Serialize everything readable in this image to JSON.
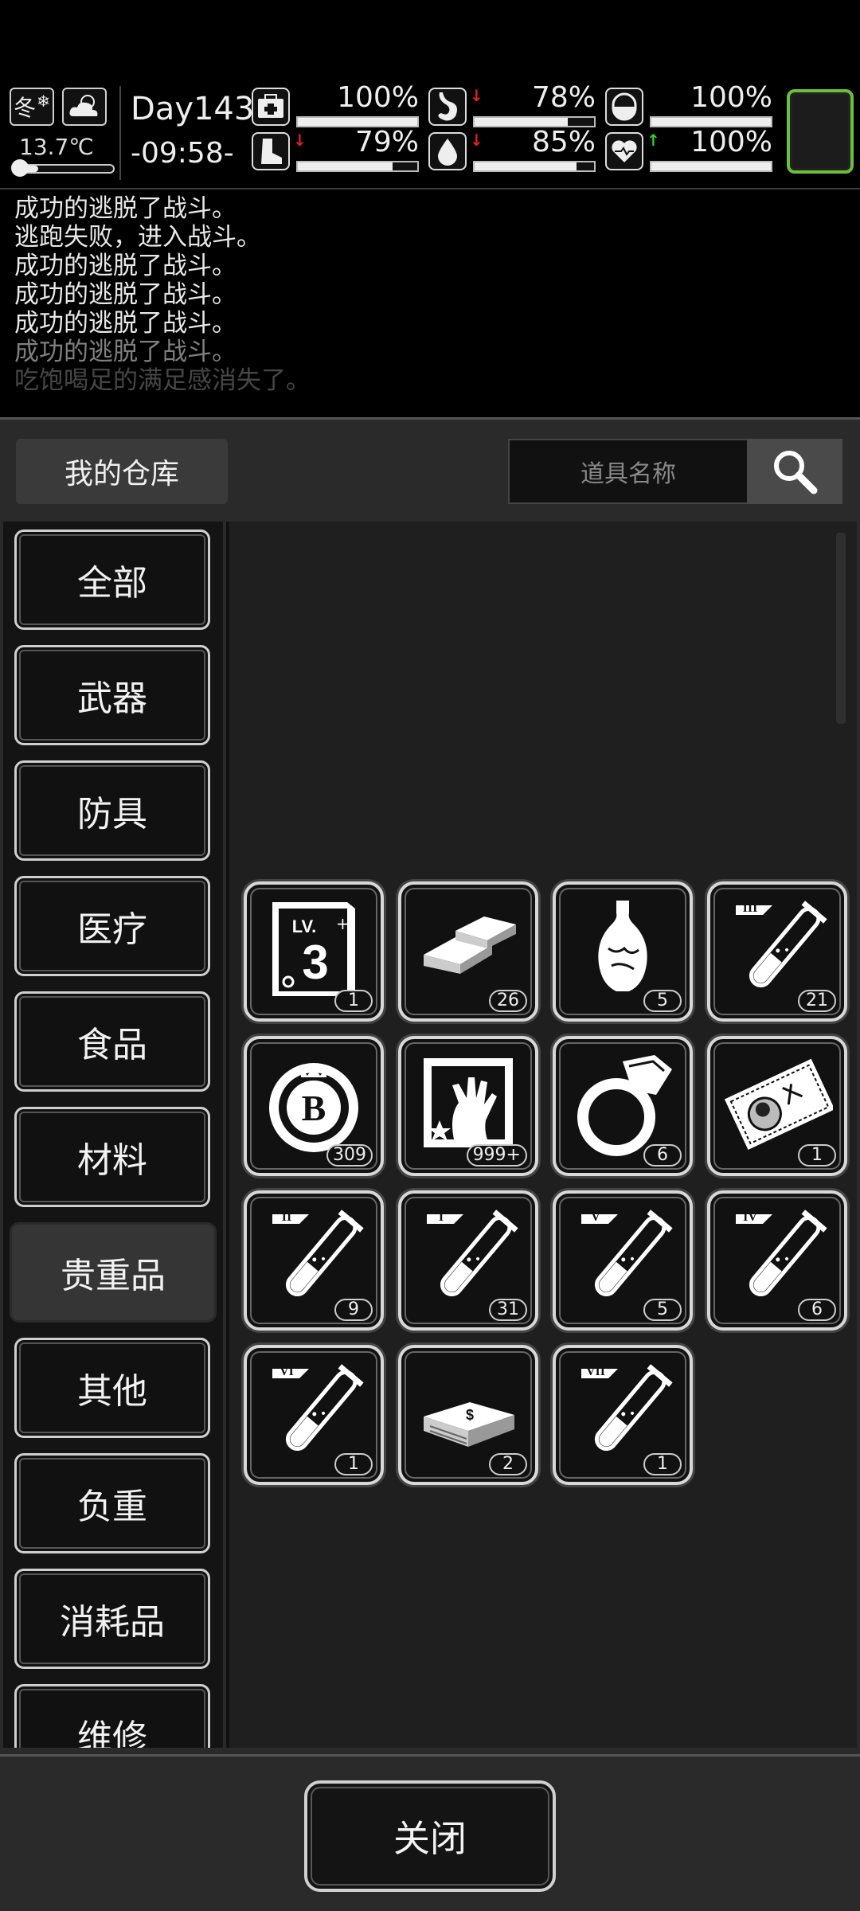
{
  "hud": {
    "season": "冬",
    "temperature": "13.7℃",
    "temperature_level": 0.22,
    "day": "Day143",
    "time": "-09:58-",
    "stats": [
      {
        "icon": "medkit-icon",
        "value": "100%",
        "level": 1.0,
        "trend": ""
      },
      {
        "icon": "stomach-icon",
        "value": "78%",
        "level": 0.78,
        "trend": "down"
      },
      {
        "icon": "pill-icon",
        "value": "100%",
        "level": 1.0,
        "trend": ""
      },
      {
        "icon": "boot-icon",
        "value": "79%",
        "level": 0.79,
        "trend": "down"
      },
      {
        "icon": "water-drop-icon",
        "value": "85%",
        "level": 0.85,
        "trend": "down"
      },
      {
        "icon": "heart-icon",
        "value": "100%",
        "level": 1.0,
        "trend": "up"
      }
    ],
    "colors": {
      "trend_down": "#e02020",
      "trend_up": "#2bd12b",
      "character_slot_border": "#6bbf3c"
    }
  },
  "log": [
    "成功的逃脱了战斗。",
    "逃跑失败，进入战斗。",
    "成功的逃脱了战斗。",
    "成功的逃脱了战斗。",
    "成功的逃脱了战斗。",
    "成功的逃脱了战斗。",
    "吃饱喝足的满足感消失了。"
  ],
  "storage": {
    "title": "我的仓库",
    "search_placeholder": "道具名称",
    "categories": [
      "全部",
      "武器",
      "防具",
      "医疗",
      "食品",
      "材料",
      "贵重品",
      "其他",
      "负重",
      "消耗品",
      "维修"
    ],
    "active_category": "贵重品",
    "items": [
      {
        "icon": "level-3-book-icon",
        "count": "1"
      },
      {
        "icon": "gold-bars-icon",
        "count": "26"
      },
      {
        "icon": "porcelain-vase-icon",
        "count": "5"
      },
      {
        "icon": "test-tube-III-icon",
        "count": "21"
      },
      {
        "icon": "bitcoin-chip-icon",
        "count": "309"
      },
      {
        "icon": "zombie-hand-card-icon",
        "count": "999+"
      },
      {
        "icon": "diamond-ring-icon",
        "count": "6"
      },
      {
        "icon": "portrait-ticket-icon",
        "count": "1"
      },
      {
        "icon": "test-tube-II-icon",
        "count": "9"
      },
      {
        "icon": "test-tube-I-icon",
        "count": "31"
      },
      {
        "icon": "test-tube-V-icon",
        "count": "5"
      },
      {
        "icon": "test-tube-IV-icon",
        "count": "6"
      },
      {
        "icon": "test-tube-VI-icon",
        "count": "1"
      },
      {
        "icon": "cash-stack-icon",
        "count": "2"
      },
      {
        "icon": "test-tube-VII-icon",
        "count": "1"
      }
    ],
    "tube_labels": [
      "III",
      "II",
      "I",
      "V",
      "IV",
      "VI",
      "VII"
    ],
    "book_label": "LV.",
    "book_number": "3",
    "chip_letter": "B",
    "close_label": "关闭"
  }
}
